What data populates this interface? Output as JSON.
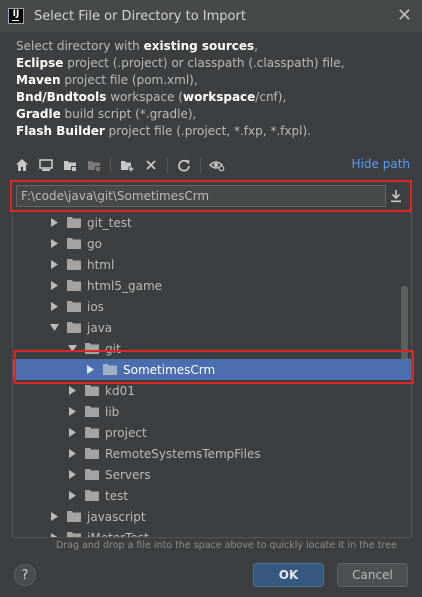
{
  "window": {
    "title": "Select File or Directory to Import",
    "app_icon_text": "IJ",
    "close_glyph": "✕"
  },
  "description": {
    "line1_prefix": "Select directory with ",
    "line1_bold": "existing sources",
    "line1_suffix": ",",
    "line2_bold": "Eclipse",
    "line2_rest": " project (.project) or classpath (.classpath) file,",
    "line3_bold": "Maven",
    "line3_rest": " project file (pom.xml),",
    "line4_bold": "Bnd/Bndtools",
    "line4_mid": " workspace (",
    "line4_bold2": "workspace",
    "line4_rest": "/cnf),",
    "line5_bold": "Gradle",
    "line5_rest": " build script (*.gradle),",
    "line6_bold": "Flash Builder",
    "line6_rest": " project file (.project, *.fxp, *.fxpl)."
  },
  "toolbar": {
    "icons": [
      "home-icon",
      "desktop-icon",
      "project-folder-icon",
      "module-folder-icon",
      "new-folder-icon",
      "delete-icon",
      "refresh-icon",
      "show-hidden-icon"
    ],
    "hide_path_label": "Hide path"
  },
  "path": {
    "value": "F:\\code\\java\\git\\SometimesCrm"
  },
  "tree": {
    "items": [
      {
        "label": "git_test",
        "depth": 0,
        "expanded": false
      },
      {
        "label": "go",
        "depth": 0,
        "expanded": false
      },
      {
        "label": "html",
        "depth": 0,
        "expanded": false
      },
      {
        "label": "html5_game",
        "depth": 0,
        "expanded": false
      },
      {
        "label": "ios",
        "depth": 0,
        "expanded": false
      },
      {
        "label": "java",
        "depth": 0,
        "expanded": true
      },
      {
        "label": "git",
        "depth": 1,
        "expanded": true
      },
      {
        "label": "SometimesCrm",
        "depth": 2,
        "expanded": false,
        "selected": true
      },
      {
        "label": "kd01",
        "depth": 1,
        "expanded": false
      },
      {
        "label": "lib",
        "depth": 1,
        "expanded": false
      },
      {
        "label": "project",
        "depth": 1,
        "expanded": false
      },
      {
        "label": "RemoteSystemsTempFiles",
        "depth": 1,
        "expanded": false
      },
      {
        "label": "Servers",
        "depth": 1,
        "expanded": false
      },
      {
        "label": "test",
        "depth": 1,
        "expanded": false
      },
      {
        "label": "javascript",
        "depth": 0,
        "expanded": false
      },
      {
        "label": "jMeterTest",
        "depth": 0,
        "expanded": false
      }
    ]
  },
  "hint": "Drag and drop a file into the space above to quickly locate it in the tree",
  "buttons": {
    "help": "?",
    "ok": "OK",
    "cancel": "Cancel"
  },
  "colors": {
    "background": "#3c3f41",
    "selection": "#4b6eaf",
    "link": "#589df6",
    "annotation_red": "#e0261f",
    "ok_button": "#365880"
  }
}
